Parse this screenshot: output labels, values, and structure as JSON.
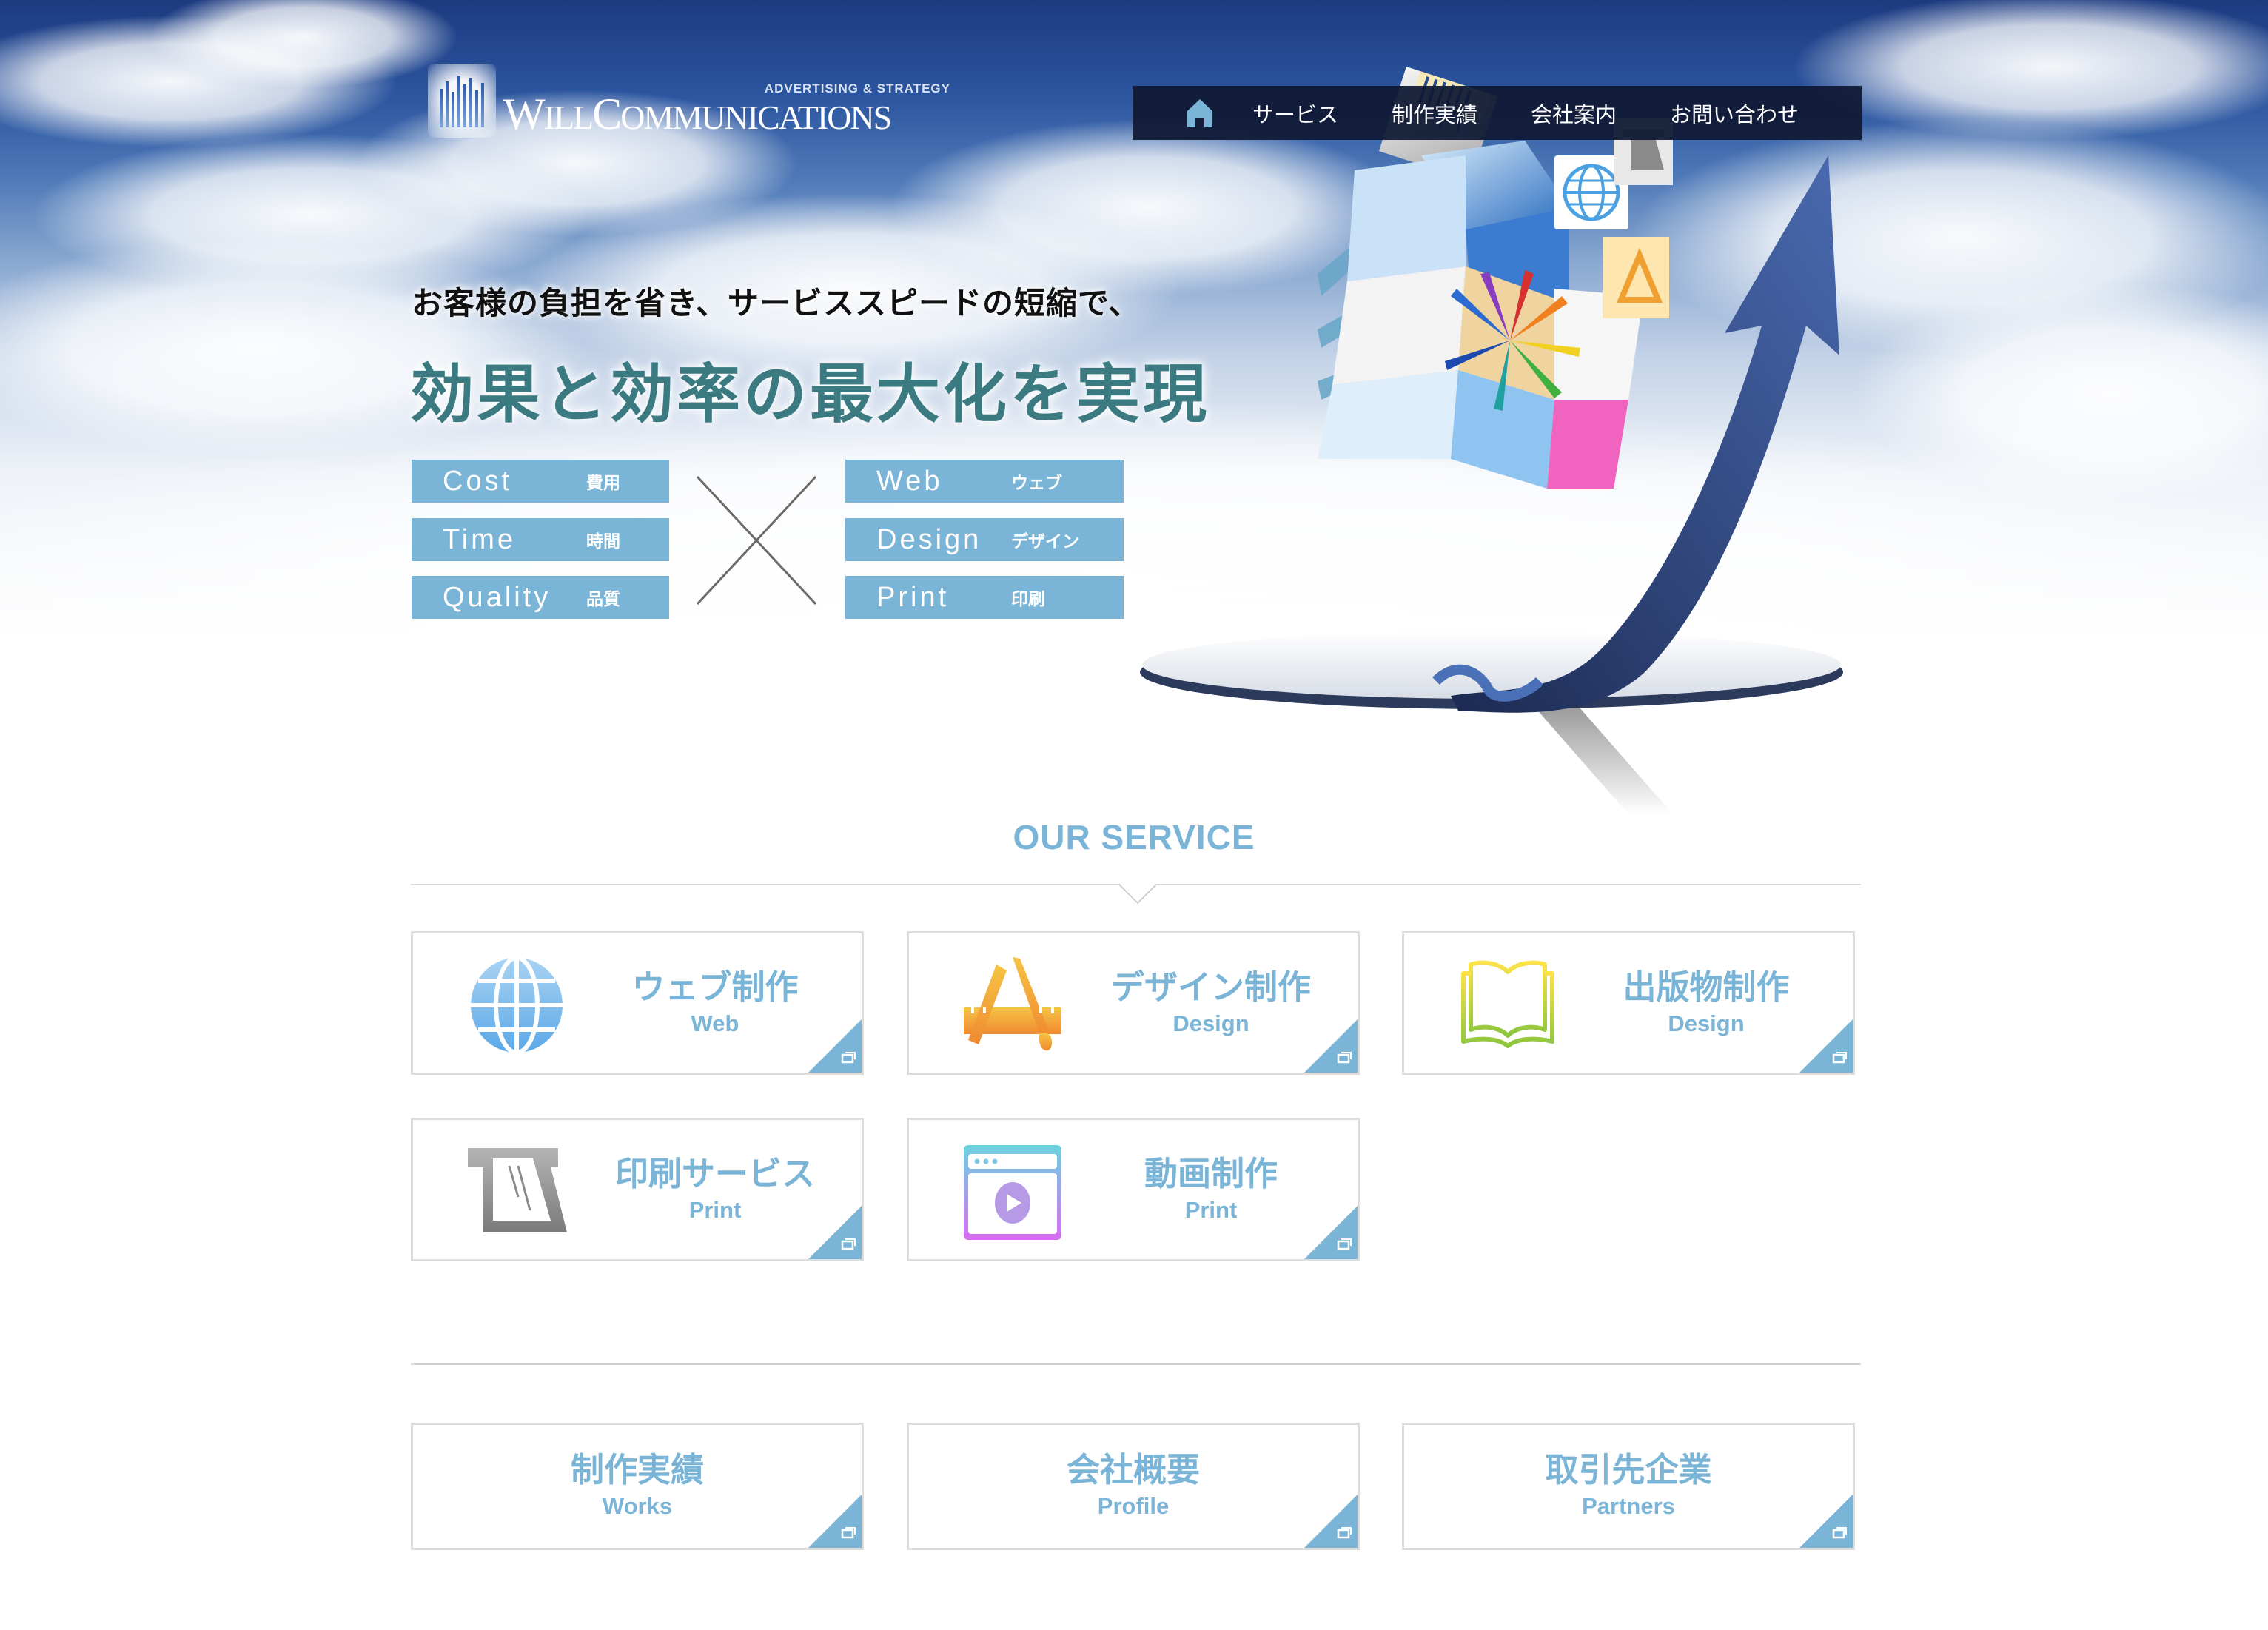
{
  "logo": {
    "tagline": "ADVERTISING & STRATEGY",
    "name_part1": "W",
    "name_part2": "ILL",
    "name_part3": "C",
    "name_part4": "OMMUNICATIONS"
  },
  "nav": {
    "home_icon": "home-icon",
    "items": [
      {
        "label": "サービス"
      },
      {
        "label": "制作実績"
      },
      {
        "label": "会社案内"
      },
      {
        "label": "お問い合わせ"
      }
    ]
  },
  "hero": {
    "subtitle": "お客様の負担を省き、サービススピードの短縮で、",
    "title": "効果と効率の最大化を実現",
    "left_pills": [
      {
        "en": "Cost",
        "jp": "費用"
      },
      {
        "en": "Time",
        "jp": "時間"
      },
      {
        "en": "Quality",
        "jp": "品質"
      }
    ],
    "right_pills": [
      {
        "en": "Web",
        "jp": "ウェブ"
      },
      {
        "en": "Design",
        "jp": "デザイン"
      },
      {
        "en": "Print",
        "jp": "印刷"
      }
    ],
    "cross_symbol": "×"
  },
  "services": {
    "heading": "OUR SERVICE",
    "cards": [
      {
        "jp": "ウェブ制作",
        "en": "Web",
        "icon": "globe-icon"
      },
      {
        "jp": "デザイン制作",
        "en": "Design",
        "icon": "design-tools-icon"
      },
      {
        "jp": "出版物制作",
        "en": "Design",
        "icon": "open-book-icon"
      },
      {
        "jp": "印刷サービス",
        "en": "Print",
        "icon": "printer-icon"
      },
      {
        "jp": "動画制作",
        "en": "Print",
        "icon": "video-player-icon"
      }
    ]
  },
  "links": {
    "cards": [
      {
        "jp": "制作実績",
        "en": "Works"
      },
      {
        "jp": "会社概要",
        "en": "Profile"
      },
      {
        "jp": "取引先企業",
        "en": "Partners"
      }
    ]
  },
  "colors": {
    "accent": "#7ab4d6",
    "nav_bg": "#101a34",
    "title_teal": "#3a7a80",
    "card_border": "#dddddd"
  }
}
